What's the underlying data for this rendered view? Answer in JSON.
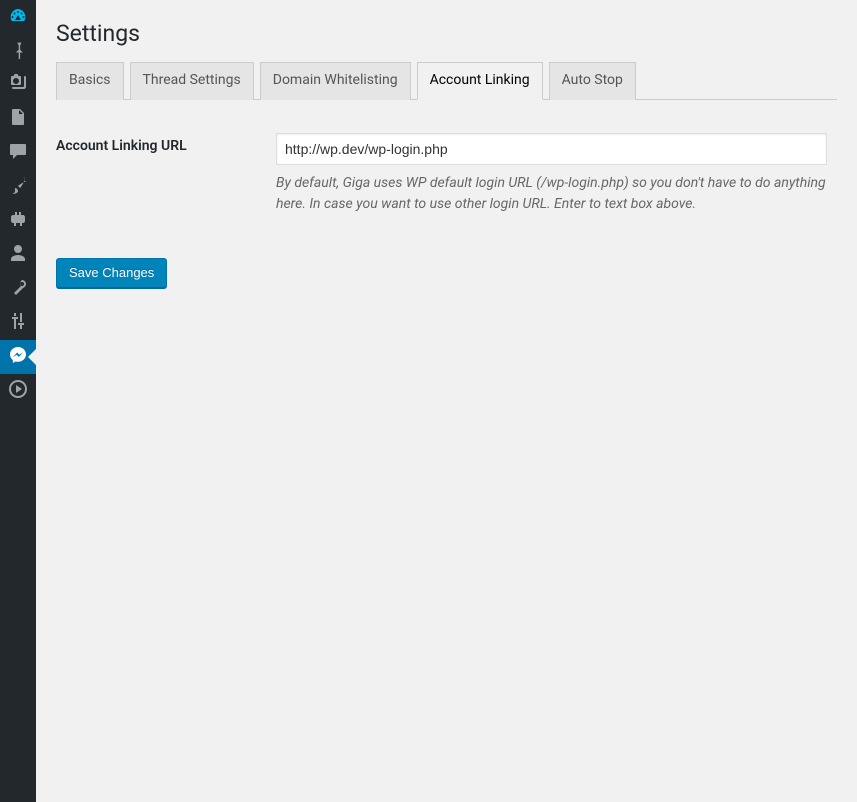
{
  "page": {
    "title": "Settings"
  },
  "tabs": {
    "basics": "Basics",
    "thread": "Thread Settings",
    "domain": "Domain Whitelisting",
    "account": "Account Linking",
    "autostop": "Auto Stop"
  },
  "form": {
    "account_linking_label": "Account Linking URL",
    "account_linking_value": "http://wp.dev/wp-login.php",
    "account_linking_description": "By default, Giga uses WP default login URL (/wp-login.php) so you don't have to do anything here. In case you want to use other login URL. Enter to text box above."
  },
  "buttons": {
    "save": "Save Changes"
  },
  "sidebar_icons": [
    "dashboard",
    "posts",
    "media",
    "pages",
    "comments",
    "appearance",
    "plugins",
    "users",
    "tools",
    "settings",
    "messenger",
    "play"
  ]
}
